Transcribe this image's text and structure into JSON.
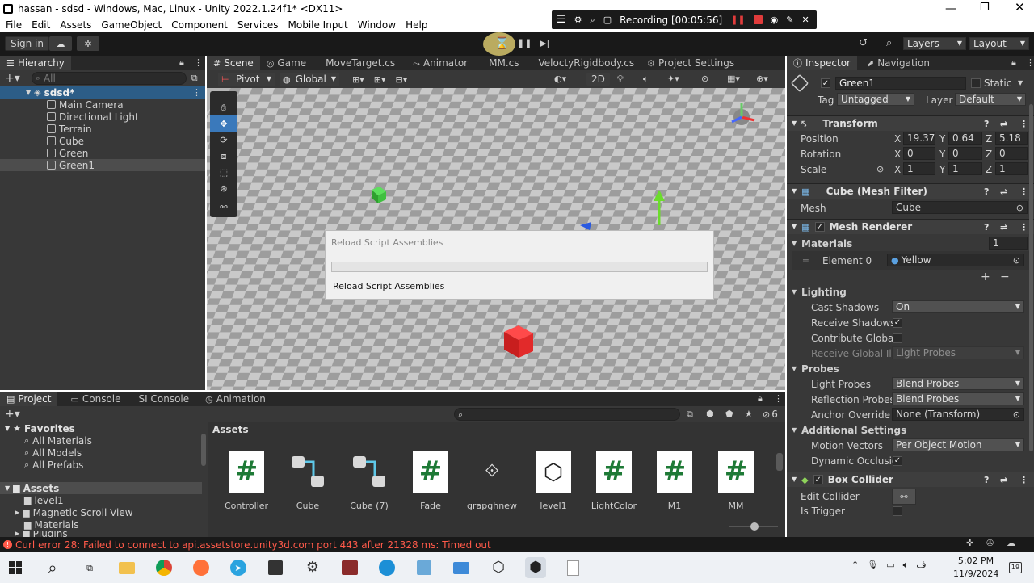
{
  "window": {
    "title": "hassan - sdsd - Windows, Mac, Linux - Unity 2022.1.24f1* <DX11>"
  },
  "recording": {
    "label": "Recording [00:05:56]"
  },
  "menu": [
    "File",
    "Edit",
    "Assets",
    "GameObject",
    "Component",
    "Services",
    "Mobile Input",
    "Window",
    "Help"
  ],
  "toolbar": {
    "signin": "Sign in",
    "layers": "Layers",
    "layout": "Layout"
  },
  "hierarchy": {
    "tab": "Hierarchy",
    "search_placeholder": "All",
    "scene": "sdsd*",
    "items": [
      "Main Camera",
      "Directional Light",
      "Terrain",
      "Cube",
      "Green",
      "Green1"
    ]
  },
  "scene_tabs": [
    "Scene",
    "Game",
    "MoveTarget.cs",
    "Animator",
    "MM.cs",
    "VeloctyRigidbody.cs",
    "Project Settings"
  ],
  "scene_toolbar": {
    "pivot": "Pivot",
    "global": "Global",
    "mode2d": "2D"
  },
  "dialog": {
    "title": "Reload Script Assemblies",
    "message": "Reload Script Assemblies",
    "progress": 0
  },
  "bottom_tabs": [
    "Project",
    "Console",
    "SI Console",
    "Animation"
  ],
  "project": {
    "favorites_label": "Favorites",
    "favorites": [
      "All Materials",
      "All Models",
      "All Prefabs"
    ],
    "assets_label": "Assets",
    "asset_folders": [
      "level1",
      "Magnetic Scroll View",
      "Materials",
      "Plugins"
    ],
    "breadcrumb": "Assets",
    "hidden_count": "6",
    "assets": [
      {
        "name": "Controller",
        "icon": "csharp-script-icon"
      },
      {
        "name": "Cube",
        "icon": "prefab-variant-icon"
      },
      {
        "name": "Cube (7)",
        "icon": "prefab-variant-icon"
      },
      {
        "name": "Fade",
        "icon": "csharp-script-icon"
      },
      {
        "name": "grapghnew",
        "icon": "graph-icon"
      },
      {
        "name": "level1",
        "icon": "unity-scene-icon"
      },
      {
        "name": "LightColor",
        "icon": "csharp-script-icon"
      },
      {
        "name": "M1",
        "icon": "csharp-script-icon"
      },
      {
        "name": "MM",
        "icon": "csharp-script-icon"
      }
    ]
  },
  "inspector": {
    "tabs": [
      "Inspector",
      "Navigation"
    ],
    "object_name": "Green1",
    "static_label": "Static",
    "tag_label": "Tag",
    "tag": "Untagged",
    "layer_label": "Layer",
    "layer": "Default",
    "transform": {
      "title": "Transform",
      "position_label": "Position",
      "position": [
        "19.37",
        "0.64",
        "5.18"
      ],
      "rotation_label": "Rotation",
      "rotation": [
        "0",
        "0",
        "0"
      ],
      "scale_label": "Scale",
      "scale": [
        "1",
        "1",
        "1"
      ]
    },
    "mesh_filter": {
      "title": "Cube (Mesh Filter)",
      "mesh_label": "Mesh",
      "mesh": "Cube"
    },
    "mesh_renderer": {
      "title": "Mesh Renderer",
      "materials_label": "Materials",
      "materials_count": "1",
      "element_label": "Element 0",
      "element_value": "Yellow",
      "lighting_label": "Lighting",
      "cast_shadows_label": "Cast Shadows",
      "cast_shadows": "On",
      "receive_shadows_label": "Receive Shadows",
      "contribute_gi_label": "Contribute Global I",
      "receive_gi_label": "Receive Global Illu",
      "receive_gi": "Light Probes",
      "probes_label": "Probes",
      "light_probes_label": "Light Probes",
      "light_probes": "Blend Probes",
      "reflection_probes_label": "Reflection Probes",
      "reflection_probes": "Blend Probes",
      "anchor_override_label": "Anchor Override",
      "anchor_override": "None (Transform)",
      "additional_label": "Additional Settings",
      "motion_vectors_label": "Motion Vectors",
      "motion_vectors": "Per Object Motion",
      "dynamic_occlusion_label": "Dynamic Occlusio"
    },
    "box_collider": {
      "title": "Box Collider",
      "edit_label": "Edit Collider",
      "is_trigger_label": "Is Trigger"
    }
  },
  "status": {
    "error": "Curl error 28: Failed to connect to api.assetstore.unity3d.com port 443 after 21328 ms: Timed out"
  },
  "taskbar": {
    "time": "5:02 PM",
    "date": "11/9/2024",
    "lang": "ف"
  },
  "colors": {
    "accent": "#3a79bb",
    "error": "#ff5a4a",
    "record": "#e03b3b"
  }
}
